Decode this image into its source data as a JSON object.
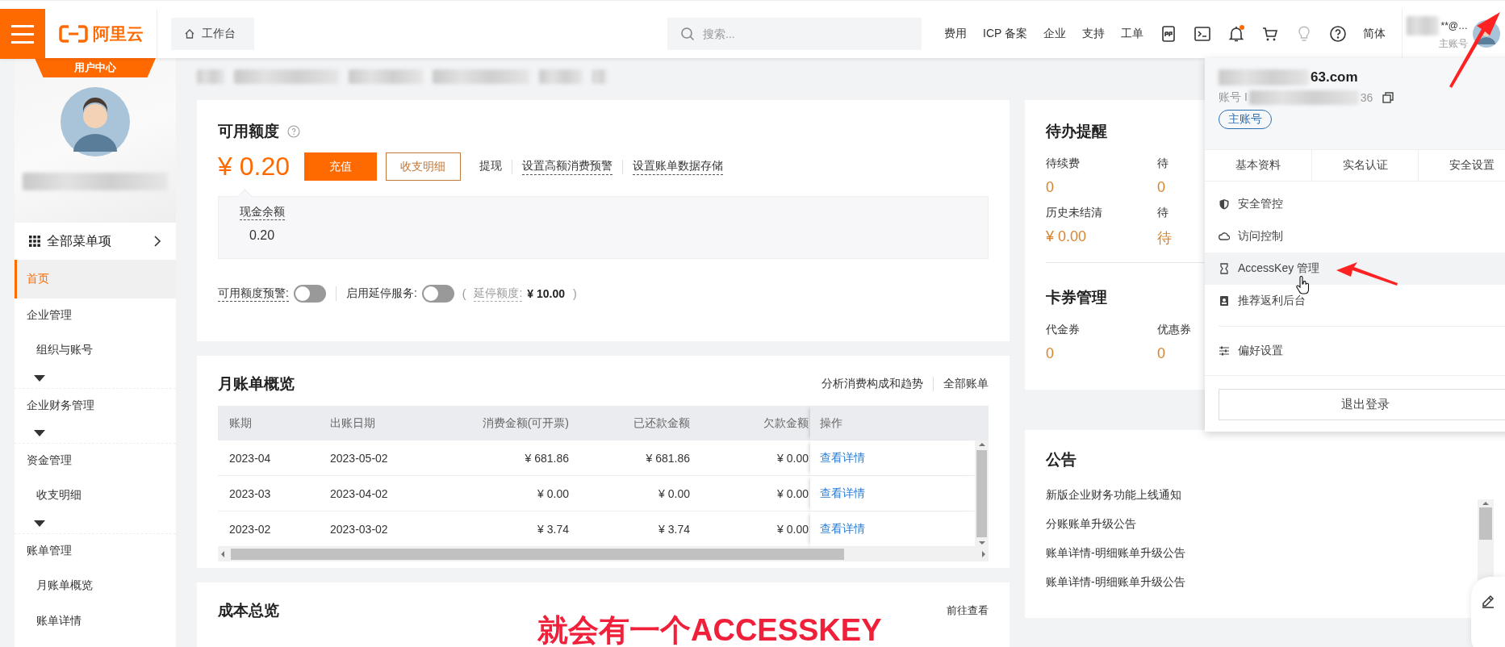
{
  "topbar": {
    "logo": "阿里云",
    "workbench": "工作台",
    "search": {
      "placeholder": "搜索..."
    },
    "links": [
      "费用",
      "ICP 备案",
      "企业",
      "支持",
      "工单"
    ],
    "notification_dot": true,
    "language": "简体",
    "user": {
      "name": "**@…",
      "role": "主账号"
    }
  },
  "sidebar": {
    "banner": "用户中心",
    "all_menu": "全部菜单项",
    "items": [
      {
        "kind": "item",
        "label": "首页",
        "selected": true,
        "collapsed": false
      },
      {
        "kind": "group",
        "label": "企业管理",
        "selected": false,
        "collapsed": false
      },
      {
        "kind": "sub",
        "label": "组织与账号",
        "selected": false,
        "collapsed": true
      },
      {
        "kind": "group",
        "label": "企业财务管理",
        "selected": false,
        "collapsed": true
      },
      {
        "kind": "group",
        "label": "资金管理",
        "selected": false,
        "collapsed": false
      },
      {
        "kind": "sub",
        "label": "收支明细",
        "selected": false,
        "collapsed": true
      },
      {
        "kind": "group",
        "label": "账单管理",
        "selected": false,
        "collapsed": false
      },
      {
        "kind": "sub",
        "label": "月账单概览",
        "selected": false,
        "collapsed": false
      },
      {
        "kind": "sub",
        "label": "账单详情",
        "selected": false,
        "collapsed": false
      }
    ]
  },
  "balance": {
    "title": "可用额度",
    "amount": "¥ 0.20",
    "buttons": [
      {
        "kind": "primary",
        "label": "充值"
      },
      {
        "kind": "outline",
        "label": "收支明细"
      }
    ],
    "links": [
      {
        "label": "提现",
        "dashed": false
      },
      {
        "label": "设置高额消费预警",
        "dashed": true
      },
      {
        "label": "设置账单数据存储",
        "dashed": true
      }
    ],
    "cash": {
      "label": "现金余额",
      "value": "0.20"
    },
    "toggles": [
      {
        "label": "可用额度预警:",
        "on": false
      },
      {
        "label": "启用延停服务:",
        "on": false
      }
    ],
    "suspend_quota": {
      "open": "(",
      "label": "延停额度:",
      "value": "¥ 10.00",
      "close": ")"
    }
  },
  "bills": {
    "title": "月账单概览",
    "links": [
      "分析消费构成和趋势",
      "全部账单"
    ],
    "columns": [
      "账期",
      "出账日期",
      "消费金额(可开票)",
      "已还款金额",
      "欠款金额",
      "操作"
    ],
    "rows": [
      {
        "cells": [
          "2023-04",
          "2023-05-02",
          "¥ 681.86",
          "¥ 681.86",
          "¥ 0.00"
        ],
        "action": "查看详情"
      },
      {
        "cells": [
          "2023-03",
          "2023-04-02",
          "¥ 0.00",
          "¥ 0.00",
          "¥ 0.00"
        ],
        "action": "查看详情"
      },
      {
        "cells": [
          "2023-02",
          "2023-03-02",
          "¥ 3.74",
          "¥ 3.74",
          "¥ 0.00"
        ],
        "action": "查看详情"
      }
    ]
  },
  "cost": {
    "title": "成本总览",
    "link": "前往查看"
  },
  "todo": {
    "title": "待办提醒",
    "items": [
      {
        "label": "待续费",
        "value": "0"
      },
      {
        "label": "待",
        "value": "0"
      },
      {
        "label": "历史未结清",
        "value": "¥ 0.00"
      },
      {
        "label": "待",
        "value": "待"
      }
    ]
  },
  "coupons": {
    "title": "卡券管理",
    "items": [
      {
        "label": "代金券",
        "value": "0"
      },
      {
        "label": "优惠券",
        "value": "0"
      }
    ]
  },
  "notices": {
    "title": "公告",
    "items": [
      "新版企业财务功能上线通知",
      "分账账单升级公告",
      "账单详情-明细账单升级公告",
      "账单详情-明细账单升级公告"
    ]
  },
  "account_menu": {
    "email": "63.com",
    "account_id_label": "账号 I",
    "account_id_end": "36",
    "badge": "主账号",
    "tabs": [
      "基本资料",
      "实名认证",
      "安全设置"
    ],
    "menu": [
      {
        "label": "安全管控",
        "hovered": false
      },
      {
        "label": "访问控制",
        "hovered": false
      },
      {
        "label": "AccessKey 管理",
        "hovered": true
      },
      {
        "label": "推荐返利后台",
        "hovered": false
      }
    ],
    "settings_item": {
      "label": "偏好设置"
    },
    "logout": "退出登录"
  },
  "annotation": "就会有一个ACCESSKEY"
}
